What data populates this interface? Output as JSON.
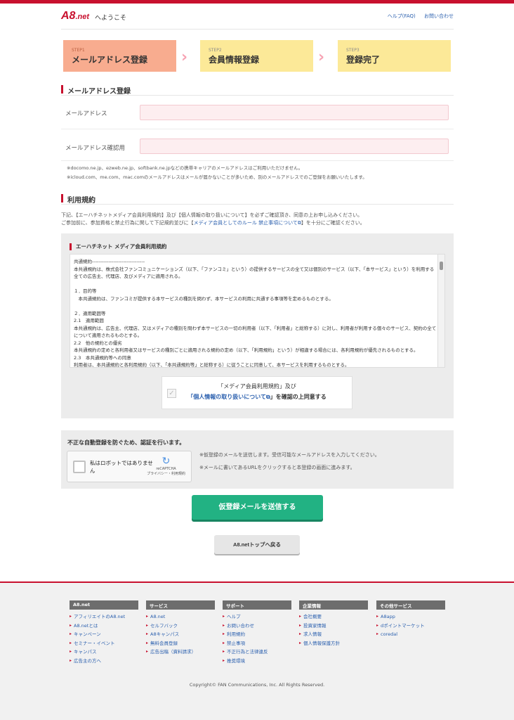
{
  "header": {
    "logo_main": "A8",
    "logo_sub": ".net",
    "welcome": "へようこそ",
    "links": [
      "ヘルプ(FAQ)",
      "お問い合わせ"
    ]
  },
  "steps": [
    {
      "num": "STEP1",
      "label": "メールアドレス登録"
    },
    {
      "num": "STEP2",
      "label": "会員情報登録"
    },
    {
      "num": "STEP3",
      "label": "登録完了"
    }
  ],
  "email_section": {
    "title": "メールアドレス登録",
    "email_label": "メールアドレス",
    "email_value": "",
    "confirm_label": "メールアドレス確認用",
    "confirm_value": "",
    "note1": "※docomo.ne.jp、ezweb.ne.jp、softbank.ne.jpなどの携帯キャリアのメールアドレスはご利用いただけません。",
    "note2": "※icloud.com、me.com、mac.comのメールアドレスはメールが届かないことが多いため、別のメールアドレスでのご登録をお願いいたします。"
  },
  "terms_section": {
    "title": "利用規約",
    "desc1": "下記、【エーハチネットメディア会員利用規約】及び【個人情報の取り扱いについて】を必ずご確認頂き、同意の上お申し込みください。",
    "desc2a": "ご参加前に、参加資格と禁止行為に関して下記規約並びに【",
    "desc2_link": "メディア会員としてのルール 禁止事項について",
    "desc2b": "】を十分にご確認ください。",
    "panel_title": "エーハチネット メディア会員利用規約",
    "terms_text": "共通規約--------------------------------\n本共通規約は、株式会社ファンコミュニケーションズ（以下、「ファンコミ」という）の提供するサービスの全て又は個別のサービス（以下、「本サービス」という）を利用する全ての広告主、代理店、及びメディアに適用される。\n\n１．目的等\n　本共通規約は、ファンコミが提供する本サービスの種別を問わず、本サービスの利用に共通する事項等を定めるものとする。\n\n２．適用範囲等\n2.1　適用範囲\n本共通規約は、広告主、代理店、又はメディアの種別を問わず本サービスの一切の利用者（以下、「利用者」と総称する）に対し、利用者が利用する個々のサービス、契約の全てについて適用されるものとする。\n2.2　他の規約との優劣\n本共通規約の定めと各利用者又はサービスの種別ごとに適用される規約の定め（以下、「利用規約」という）が相違する場合には、各利用規約が優先されるものとする。\n2.3　本共通規約等への同意\n利用者は、本共通規約と各利用規約（以下、「本共通規約等」と総称する）に従うことに同意して、本サービスを利用するものとする。",
    "agree_line1": "「メディア会員利用規約」及び",
    "agree_link": "「個人情報の取り扱いについて",
    "agree_line2b": "」を確認の上同意する",
    "agree_checked": true
  },
  "captcha": {
    "title": "不正な自動登録を防ぐため、認証を行います。",
    "checkbox_label": "私はロボットではありません",
    "brand": "reCAPTCHA",
    "privacy": "プライバシー・利用規約",
    "note1": "※仮登録のメールを送信します。受信可能なメールアドレスを入力してください。",
    "note2": "※メールに書いてあるURLをクリックすると本登録の画面に進みます。"
  },
  "buttons": {
    "submit": "仮登録メールを送信する",
    "top": "A8.netトップへ戻る"
  },
  "footer": {
    "columns": [
      {
        "title": "A8.net",
        "items": [
          "アフィリエイトのA8.net",
          "A8.netとは",
          "キャンペーン",
          "セミナー・イベント",
          "キャンパス",
          "広告主の方へ"
        ]
      },
      {
        "title": "サービス",
        "items": [
          "A8.net",
          "セルフバック",
          "A8キャンパス",
          "無料会員登録",
          "広告出稿（資料請求）"
        ]
      },
      {
        "title": "サポート",
        "items": [
          "ヘルプ",
          "お問い合わせ",
          "利用規約",
          "禁止事項",
          "不正行為と法律違反",
          "推奨環境"
        ]
      },
      {
        "title": "企業情報",
        "items": [
          "会社概要",
          "投資家情報",
          "求人情報",
          "個人情報保護方針"
        ]
      },
      {
        "title": "その他サービス",
        "items": [
          "A8app",
          "dポイントマーケット",
          "coredal"
        ]
      }
    ],
    "copyright": "Copyright© FAN Communications, Inc. All Rights Reserved."
  }
}
